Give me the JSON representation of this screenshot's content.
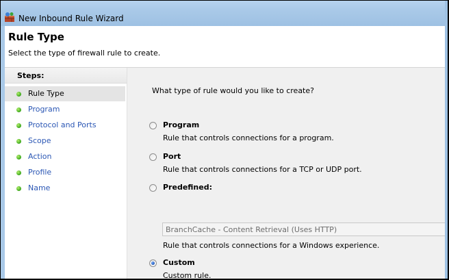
{
  "window": {
    "title": "New Inbound Rule Wizard",
    "icon": "firewall-wizard-icon"
  },
  "header": {
    "title": "Rule Type",
    "subtitle": "Select the type of firewall rule to create."
  },
  "steps": {
    "heading": "Steps:",
    "items": [
      {
        "label": "Rule Type",
        "active": true
      },
      {
        "label": "Program",
        "active": false
      },
      {
        "label": "Protocol and Ports",
        "active": false
      },
      {
        "label": "Scope",
        "active": false
      },
      {
        "label": "Action",
        "active": false
      },
      {
        "label": "Profile",
        "active": false
      },
      {
        "label": "Name",
        "active": false
      }
    ]
  },
  "main": {
    "question": "What type of rule would you like to create?",
    "options": [
      {
        "label": "Program",
        "description": "Rule that controls connections for a program.",
        "checked": false
      },
      {
        "label": "Port",
        "description": "Rule that controls connections for a TCP or UDP port.",
        "checked": false
      },
      {
        "label": "Predefined:",
        "description": "Rule that controls connections for a Windows experience.",
        "checked": false
      },
      {
        "label": "Custom",
        "description": "Custom rule.",
        "checked": true
      }
    ],
    "predefined_select": "BranchCache - Content Retrieval (Uses HTTP)"
  },
  "colors": {
    "step_link": "#2a56b4",
    "step_dot": "#38a51a",
    "content_bg": "#f0f0f0"
  }
}
